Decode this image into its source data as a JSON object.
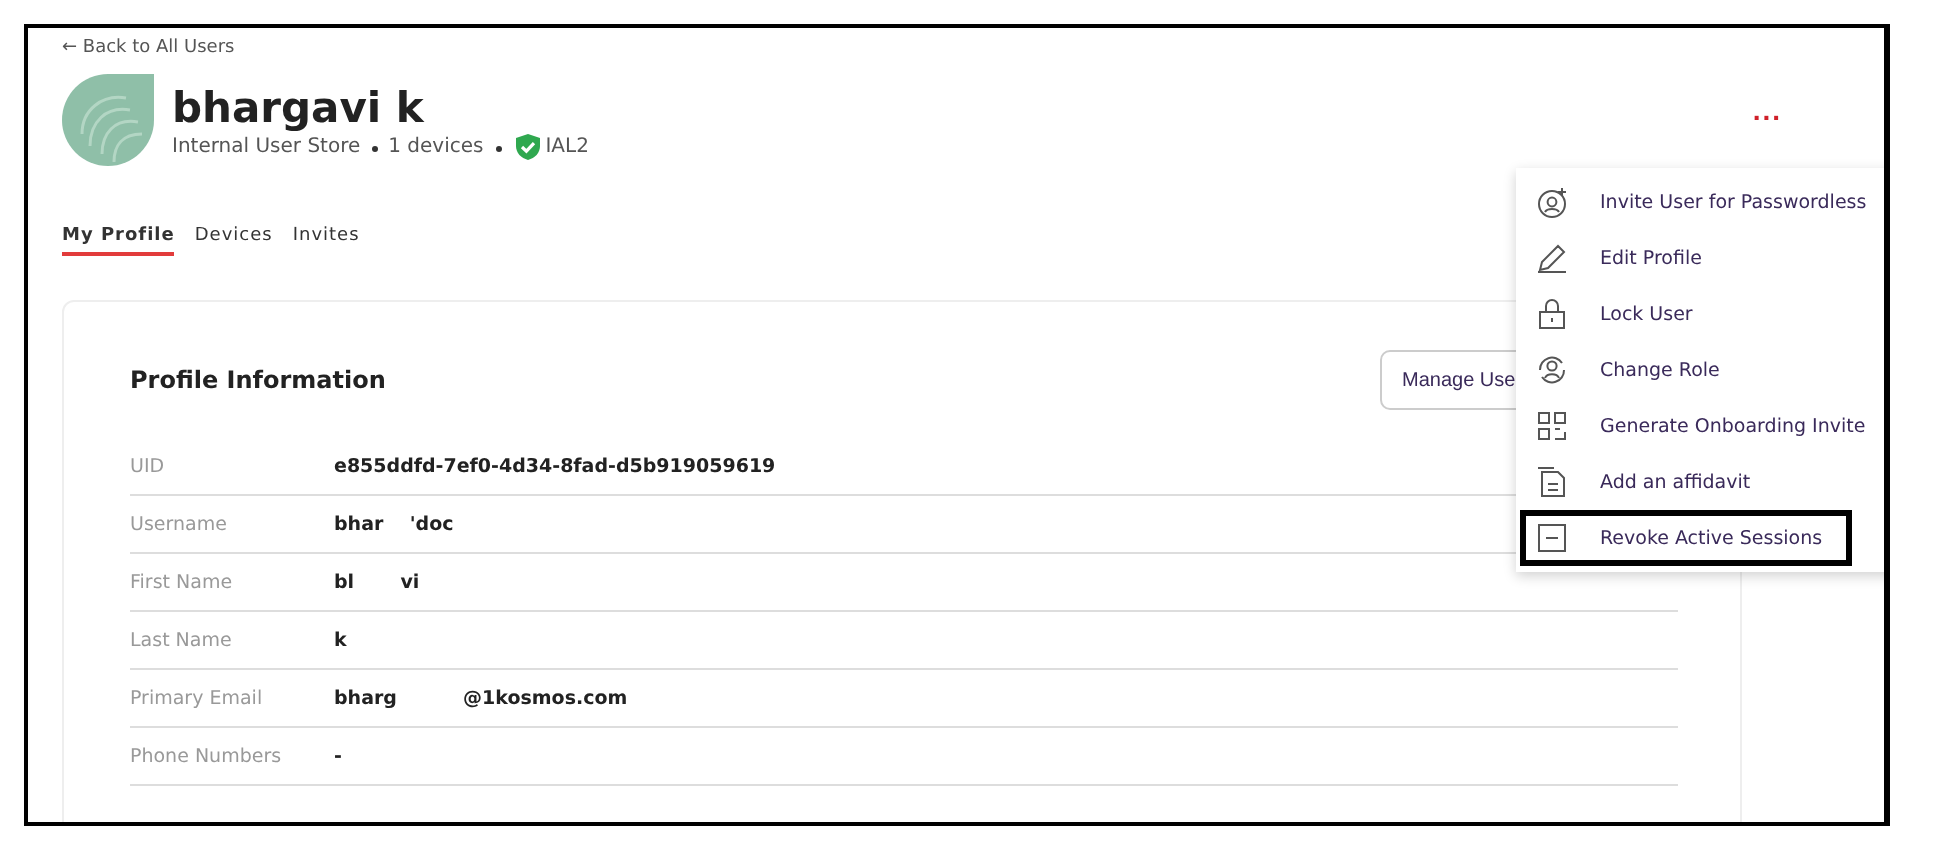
{
  "back_link": "← Back to All Users",
  "user": {
    "name": "bhargavi k",
    "store": "Internal User Store",
    "devices": "1 devices",
    "level": "IAL2"
  },
  "more_button": "...",
  "tabs": [
    {
      "label": "My Profile",
      "selected": true
    },
    {
      "label": "Devices",
      "selected": false
    },
    {
      "label": "Invites",
      "selected": false
    }
  ],
  "profile": {
    "title": "Profile Information",
    "button": "Manage Use",
    "rows": [
      {
        "label": "UID",
        "value": "e855ddfd-7ef0-4d34-8fad-d5b919059619"
      },
      {
        "label": "Username",
        "value": "bhar    'doc"
      },
      {
        "label": "First Name",
        "value": "bl       vi"
      },
      {
        "label": "Last Name",
        "value": "k"
      },
      {
        "label": "Primary Email",
        "value": "bharg          @1kosmos.com"
      },
      {
        "label": "Phone Numbers",
        "value": "-"
      }
    ]
  },
  "menu": {
    "items": [
      {
        "kind": "invite",
        "label": "Invite User for Passwordless",
        "selected": false
      },
      {
        "kind": "edit",
        "label": "Edit Profile",
        "selected": false
      },
      {
        "kind": "lock",
        "label": "Lock User",
        "selected": false
      },
      {
        "kind": "role",
        "label": "Change Role",
        "selected": false
      },
      {
        "kind": "qr",
        "label": "Generate Onboarding Invite",
        "selected": false
      },
      {
        "kind": "doc",
        "label": "Add an affidavit",
        "selected": false
      },
      {
        "kind": "revoke",
        "label": "Revoke Active Sessions",
        "selected": true
      }
    ]
  }
}
